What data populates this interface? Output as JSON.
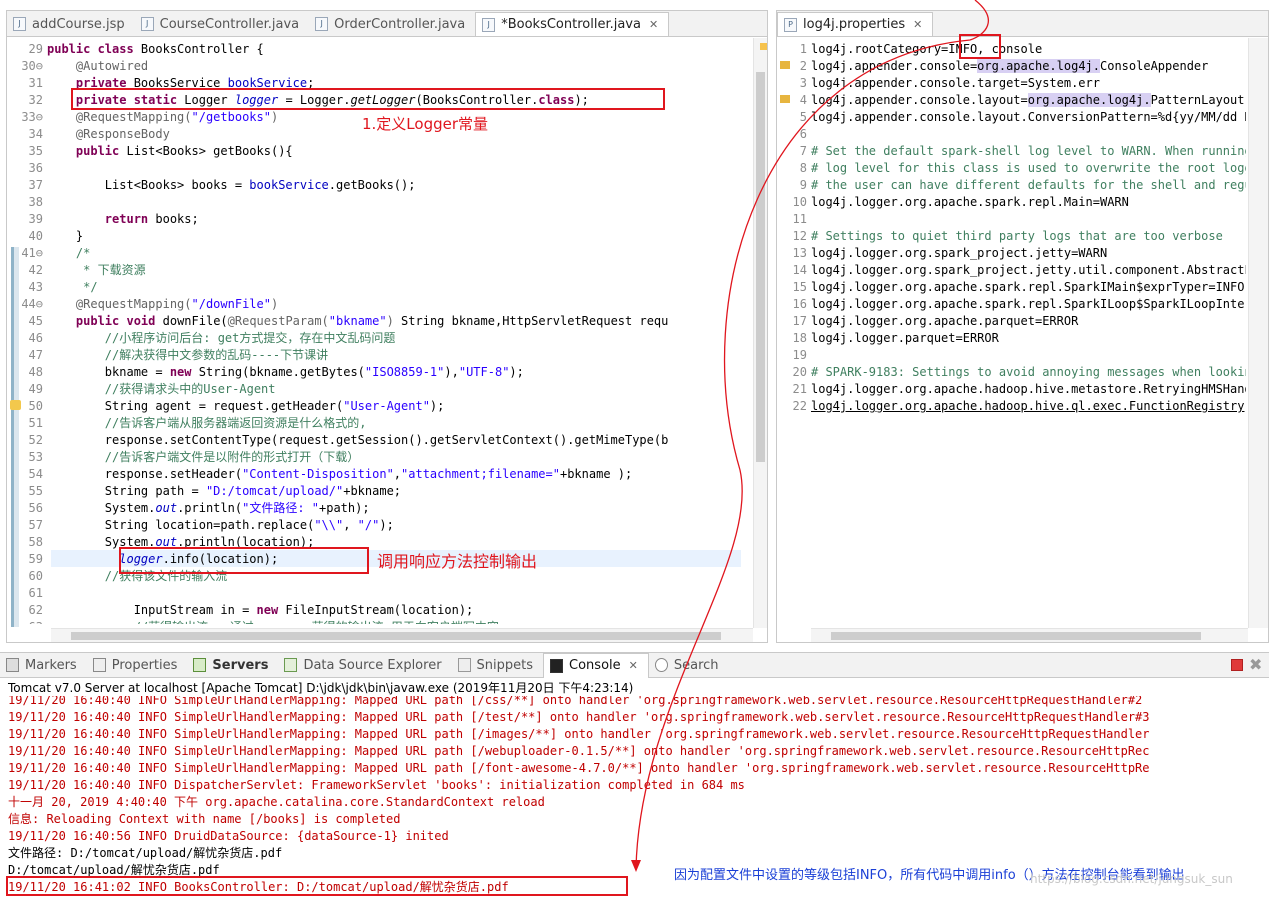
{
  "editor": {
    "tabs": [
      {
        "label": "addCourse.jsp",
        "icon": "jsp-file-icon"
      },
      {
        "label": "CourseController.java",
        "icon": "java-file-icon"
      },
      {
        "label": "OrderController.java",
        "icon": "java-file-icon"
      },
      {
        "label": "*BooksController.java",
        "icon": "java-file-icon",
        "active": true
      }
    ],
    "close_glyph": "✕"
  },
  "properties_editor": {
    "tab_label": "log4j.properties",
    "close_glyph": "✕"
  },
  "java_lines": [
    {
      "n": "29",
      "html": "<span class=\"kw\">public class</span> BooksController {"
    },
    {
      "n": "30⊖",
      "html": "    <span class=\"an\">@Autowired</span>"
    },
    {
      "n": "31",
      "html": "    <span class=\"kw\">private</span> BooksService <span class=\"fd\">bookService</span>;"
    },
    {
      "n": "32",
      "html": "    <span class=\"kw\">private static</span> Logger <span class=\"fdi\">logger</span> = Logger.<span class=\"mi\">getLogger</span>(BooksController.<span class=\"kw\">class</span>);"
    },
    {
      "n": "33⊖",
      "html": "    <span class=\"an\">@RequestMapping(</span><span class=\"st\">\"/getbooks\"</span><span class=\"an\">)</span>"
    },
    {
      "n": "34",
      "html": "    <span class=\"an\">@ResponseBody</span>"
    },
    {
      "n": "35",
      "html": "    <span class=\"kw\">public</span> List&lt;Books&gt; getBooks(){"
    },
    {
      "n": "36",
      "html": ""
    },
    {
      "n": "37",
      "html": "        List&lt;Books&gt; books = <span class=\"fd\">bookService</span>.getBooks();"
    },
    {
      "n": "38",
      "html": ""
    },
    {
      "n": "39",
      "html": "        <span class=\"kw\">return</span> books;"
    },
    {
      "n": "40",
      "html": "    }"
    },
    {
      "n": "41⊖",
      "html": "    <span class=\"cm\">/*</span>"
    },
    {
      "n": "42",
      "html": "     <span class=\"cm\">* 下载资源</span>"
    },
    {
      "n": "43",
      "html": "     <span class=\"cm\">*/</span>"
    },
    {
      "n": "44⊖",
      "html": "    <span class=\"an\">@RequestMapping(</span><span class=\"st\">\"/downFile\"</span><span class=\"an\">)</span>"
    },
    {
      "n": "45",
      "html": "    <span class=\"kw\">public void</span> downFile(<span class=\"an\">@RequestParam(</span><span class=\"st\">\"bkname\"</span><span class=\"an\">)</span> String bkname,HttpServletRequest requ"
    },
    {
      "n": "46",
      "html": "        <span class=\"cm\">//小程序访问后台: get方式提交，存在中文乱码问题</span>"
    },
    {
      "n": "47",
      "html": "        <span class=\"cm\">//解决获得中文参数的乱码----下节课讲</span>"
    },
    {
      "n": "48",
      "html": "        bkname = <span class=\"kw\">new</span> String(bkname.getBytes(<span class=\"st\">\"ISO8859-1\"</span>),<span class=\"st\">\"UTF-8\"</span>);"
    },
    {
      "n": "49",
      "html": "        <span class=\"cm\">//获得请求头中的User-Agent</span>"
    },
    {
      "n": "50",
      "html": "        String agent = request.getHeader(<span class=\"st\">\"User-Agent\"</span>);"
    },
    {
      "n": "51",
      "html": "        <span class=\"cm\">//告诉客户端从服务器端返回资源是什么格式的,</span>"
    },
    {
      "n": "52",
      "html": "        response.setContentType(request.getSession().getServletContext().getMimeType(b"
    },
    {
      "n": "53",
      "html": "        <span class=\"cm\">//告诉客户端文件是以附件的形式打开（下载）</span>"
    },
    {
      "n": "54",
      "html": "        response.setHeader(<span class=\"st\">\"Content-Disposition\"</span>,<span class=\"st\">\"attachment;filename=\"</span>+bkname );"
    },
    {
      "n": "55",
      "html": "        String path = <span class=\"st\">\"D:/tomcat/upload/\"</span>+bkname;"
    },
    {
      "n": "56",
      "html": "        System.<span class=\"fdi\">out</span>.println(<span class=\"st\">\"文件路径: \"</span>+path);"
    },
    {
      "n": "57",
      "html": "        String location=path.replace(<span class=\"st\">\"\\\\\"</span>, <span class=\"st\">\"/\"</span>);"
    },
    {
      "n": "58",
      "html": "        System.<span class=\"fdi\">out</span>.println(location);"
    },
    {
      "n": "59",
      "html": "          <span class=\"fdi\">logger</span>.info(location);"
    },
    {
      "n": "60",
      "html": "        <span class=\"cm\">//获得该文件的输入流</span>"
    },
    {
      "n": "61",
      "html": ""
    },
    {
      "n": "62",
      "html": "            InputStream in = <span class=\"kw\">new</span> FileInputStream(location);"
    },
    {
      "n": "63",
      "html": "            <span class=\"cm\">//获得输出流---通过response获得的输出流 用于向客户端写内容</span>"
    }
  ],
  "prop_lines": [
    {
      "n": "1",
      "html": "log4j.rootCategory=INFO, console"
    },
    {
      "n": "2",
      "html": "log4j.appender.console=<span style=\"background:#d8d0f3\">org.apache.log4j.</span>ConsoleAppender"
    },
    {
      "n": "3",
      "html": "log4j.appender.console.target=System.err"
    },
    {
      "n": "4",
      "html": "log4j.appender.console.layout=<span style=\"background:#d8d0f3\">org.apache.log4j.</span>PatternLayout"
    },
    {
      "n": "5",
      "html": "log4j.appender.console.layout.ConversionPattern=%d{yy/MM/dd HH:mm:ss}"
    },
    {
      "n": "6",
      "html": ""
    },
    {
      "n": "7",
      "html": "<span class=\"cm\"># Set the default spark-shell log level to WARN. When running</span>"
    },
    {
      "n": "8",
      "html": "<span class=\"cm\"># log level for this class is used to overwrite the root logger's</span>"
    },
    {
      "n": "9",
      "html": "<span class=\"cm\"># the user can have different defaults for the shell and regular</span>"
    },
    {
      "n": "10",
      "html": "log4j.logger.org.apache.spark.repl.Main=WARN"
    },
    {
      "n": "11",
      "html": ""
    },
    {
      "n": "12",
      "html": "<span class=\"cm\"># Settings to quiet third party logs that are too verbose</span>"
    },
    {
      "n": "13",
      "html": "log4j.logger.org.spark_project.jetty=WARN"
    },
    {
      "n": "14",
      "html": "log4j.logger.org.spark_project.jetty.util.component.AbstractLifeCycle"
    },
    {
      "n": "15",
      "html": "log4j.logger.org.apache.spark.repl.SparkIMain$exprTyper=INFO"
    },
    {
      "n": "16",
      "html": "log4j.logger.org.apache.spark.repl.SparkILoop$SparkILoopInterpreter"
    },
    {
      "n": "17",
      "html": "log4j.logger.org.apache.parquet=ERROR"
    },
    {
      "n": "18",
      "html": "log4j.logger.parquet=ERROR"
    },
    {
      "n": "19",
      "html": ""
    },
    {
      "n": "20",
      "html": "<span class=\"cm\"># SPARK-9183: Settings to avoid annoying messages when looking up</span>"
    },
    {
      "n": "21",
      "html": "log4j.logger.org.apache.hadoop.hive.metastore.RetryingHMSHandler"
    },
    {
      "n": "22",
      "html": "<u>log4j.logger.org.apache.hadoop.hive.ql.exec.FunctionRegistry</u>"
    }
  ],
  "views": {
    "tabs": [
      {
        "label": "Markers",
        "icon": "markers-icon"
      },
      {
        "label": "Properties",
        "icon": "properties-icon"
      },
      {
        "label": "Servers",
        "icon": "servers-icon"
      },
      {
        "label": "Data Source Explorer",
        "icon": "data-source-icon"
      },
      {
        "label": "Snippets",
        "icon": "snippets-icon"
      },
      {
        "label": "Console",
        "icon": "console-icon",
        "active": true
      },
      {
        "label": "Search",
        "icon": "search-icon"
      }
    ],
    "console_title": "Tomcat v7.0 Server at localhost [Apache Tomcat] D:\\jdk\\jdk\\bin\\javaw.exe (2019年11月20日 下午4:23:14)"
  },
  "console_lines": [
    {
      "cls": "err",
      "text": "19/11/20 16:40:40 INFO SimpleUrlHandlerMapping: Mapped URL path [/css/**] onto handler 'org.springframework.web.servlet.resource.ResourceHttpRequestHandler#2"
    },
    {
      "cls": "err",
      "text": "19/11/20 16:40:40 INFO SimpleUrlHandlerMapping: Mapped URL path [/test/**] onto handler 'org.springframework.web.servlet.resource.ResourceHttpRequestHandler#3"
    },
    {
      "cls": "err",
      "text": "19/11/20 16:40:40 INFO SimpleUrlHandlerMapping: Mapped URL path [/images/**] onto handler 'org.springframework.web.servlet.resource.ResourceHttpRequestHandler"
    },
    {
      "cls": "err",
      "text": "19/11/20 16:40:40 INFO SimpleUrlHandlerMapping: Mapped URL path [/webuploader-0.1.5/**] onto handler 'org.springframework.web.servlet.resource.ResourceHttpRec"
    },
    {
      "cls": "err",
      "text": "19/11/20 16:40:40 INFO SimpleUrlHandlerMapping: Mapped URL path [/font-awesome-4.7.0/**] onto handler 'org.springframework.web.servlet.resource.ResourceHttpRe"
    },
    {
      "cls": "err",
      "text": "19/11/20 16:40:40 INFO DispatcherServlet: FrameworkServlet 'books': initialization completed in 684 ms"
    },
    {
      "cls": "err",
      "text": "十一月 20, 2019 4:40:40 下午 org.apache.catalina.core.StandardContext reload"
    },
    {
      "cls": "err",
      "text": "信息: Reloading Context with name [/books] is completed"
    },
    {
      "cls": "err",
      "text": "19/11/20 16:40:56 INFO DruidDataSource: {dataSource-1} inited"
    },
    {
      "cls": "out",
      "text": "文件路径: D:/tomcat/upload/解忧杂货店.pdf"
    },
    {
      "cls": "out",
      "text": "D:/tomcat/upload/解忧杂货店.pdf"
    },
    {
      "cls": "err",
      "text": "19/11/20 16:41:02 INFO BooksController: D:/tomcat/upload/解忧杂货店.pdf"
    }
  ],
  "annotations": {
    "define_logger": "1.定义Logger常量",
    "call_method": "调用响应方法控制输出",
    "explanation": "因为配置文件中设置的等级包括INFO，所有代码中调用info（）方法在控制台能看到输出"
  },
  "watermark": "https://blog.csdn.net/jungsuk_sun",
  "colors": {
    "annotation_red": "#e0161e",
    "annotation_blue": "#1a3fd6",
    "console_stderr": "#c00000"
  }
}
